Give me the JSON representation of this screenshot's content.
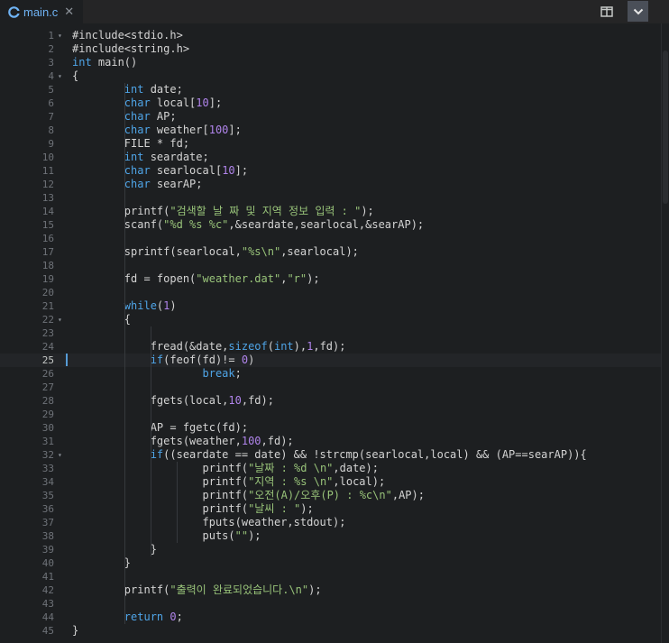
{
  "tab": {
    "title": "main.c",
    "close": "✕"
  },
  "colors": {
    "keyword": "#4fa5e8",
    "string": "#98c379",
    "number": "#b084eb",
    "text": "#d4d4d4"
  },
  "lines": [
    [
      [
        "pre",
        "#include<stdio.h>"
      ]
    ],
    [
      [
        "pre",
        "#include<string.h>"
      ]
    ],
    [
      [
        "kw",
        "int"
      ],
      [
        "t",
        " main()"
      ]
    ],
    [
      [
        "t",
        "{"
      ]
    ],
    [
      [
        "t",
        "        "
      ],
      [
        "kw",
        "int"
      ],
      [
        "t",
        " date;"
      ]
    ],
    [
      [
        "t",
        "        "
      ],
      [
        "kw",
        "char"
      ],
      [
        "t",
        " local["
      ],
      [
        "num",
        "10"
      ],
      [
        "t",
        "];"
      ]
    ],
    [
      [
        "t",
        "        "
      ],
      [
        "kw",
        "char"
      ],
      [
        "t",
        " AP;"
      ]
    ],
    [
      [
        "t",
        "        "
      ],
      [
        "kw",
        "char"
      ],
      [
        "t",
        " weather["
      ],
      [
        "num",
        "100"
      ],
      [
        "t",
        "];"
      ]
    ],
    [
      [
        "t",
        "        FILE * fd;"
      ]
    ],
    [
      [
        "t",
        "        "
      ],
      [
        "kw",
        "int"
      ],
      [
        "t",
        " seardate;"
      ]
    ],
    [
      [
        "t",
        "        "
      ],
      [
        "kw",
        "char"
      ],
      [
        "t",
        " searlocal["
      ],
      [
        "num",
        "10"
      ],
      [
        "t",
        "];"
      ]
    ],
    [
      [
        "t",
        "        "
      ],
      [
        "kw",
        "char"
      ],
      [
        "t",
        " searAP;"
      ]
    ],
    [
      [
        "t",
        ""
      ]
    ],
    [
      [
        "t",
        "        printf("
      ],
      [
        "str",
        "\"검색할 날 짜 및 지역 정보 입력 : \""
      ],
      [
        "t",
        ");"
      ]
    ],
    [
      [
        "t",
        "        scanf("
      ],
      [
        "str",
        "\"%d %s %c\""
      ],
      [
        "t",
        ",&seardate,searlocal,&searAP);"
      ]
    ],
    [
      [
        "t",
        ""
      ]
    ],
    [
      [
        "t",
        "        sprintf(searlocal,"
      ],
      [
        "str",
        "\"%s\\n\""
      ],
      [
        "t",
        ",searlocal);"
      ]
    ],
    [
      [
        "t",
        ""
      ]
    ],
    [
      [
        "t",
        "        fd = fopen("
      ],
      [
        "str",
        "\"weather.dat\""
      ],
      [
        "t",
        ","
      ],
      [
        "str",
        "\"r\""
      ],
      [
        "t",
        ");"
      ]
    ],
    [
      [
        "t",
        ""
      ]
    ],
    [
      [
        "t",
        "        "
      ],
      [
        "kw",
        "while"
      ],
      [
        "t",
        "("
      ],
      [
        "num",
        "1"
      ],
      [
        "t",
        ")"
      ]
    ],
    [
      [
        "t",
        "        {"
      ]
    ],
    [
      [
        "t",
        ""
      ]
    ],
    [
      [
        "t",
        "            fread(&date,"
      ],
      [
        "kw",
        "sizeof"
      ],
      [
        "t",
        "("
      ],
      [
        "kw",
        "int"
      ],
      [
        "t",
        "),"
      ],
      [
        "num",
        "1"
      ],
      [
        "t",
        ",fd);"
      ]
    ],
    [
      [
        "t",
        "            "
      ],
      [
        "kw",
        "if"
      ],
      [
        "t",
        "(feof(fd)!= "
      ],
      [
        "num",
        "0"
      ],
      [
        "t",
        ")"
      ]
    ],
    [
      [
        "t",
        "                    "
      ],
      [
        "kw",
        "break"
      ],
      [
        "t",
        ";"
      ]
    ],
    [
      [
        "t",
        ""
      ]
    ],
    [
      [
        "t",
        "            fgets(local,"
      ],
      [
        "num",
        "10"
      ],
      [
        "t",
        ",fd);"
      ]
    ],
    [
      [
        "t",
        ""
      ]
    ],
    [
      [
        "t",
        "            AP = fgetc(fd);"
      ]
    ],
    [
      [
        "t",
        "            fgets(weather,"
      ],
      [
        "num",
        "100"
      ],
      [
        "t",
        ",fd);"
      ]
    ],
    [
      [
        "t",
        "            "
      ],
      [
        "kw",
        "if"
      ],
      [
        "t",
        "((seardate == date) && !strcmp(searlocal,local) && (AP==searAP)){"
      ]
    ],
    [
      [
        "t",
        "                    printf("
      ],
      [
        "str",
        "\"날짜 : %d \\n\""
      ],
      [
        "t",
        ",date);"
      ]
    ],
    [
      [
        "t",
        "                    printf("
      ],
      [
        "str",
        "\"지역 : %s \\n\""
      ],
      [
        "t",
        ",local);"
      ]
    ],
    [
      [
        "t",
        "                    printf("
      ],
      [
        "str",
        "\"오전(A)/오후(P) : %c\\n\""
      ],
      [
        "t",
        ",AP);"
      ]
    ],
    [
      [
        "t",
        "                    printf("
      ],
      [
        "str",
        "\"날씨 : \""
      ],
      [
        "t",
        ");"
      ]
    ],
    [
      [
        "t",
        "                    fputs(weather,stdout);"
      ]
    ],
    [
      [
        "t",
        "                    puts("
      ],
      [
        "str",
        "\"\""
      ],
      [
        "t",
        ");"
      ]
    ],
    [
      [
        "t",
        "            }"
      ]
    ],
    [
      [
        "t",
        "        }"
      ]
    ],
    [
      [
        "t",
        ""
      ]
    ],
    [
      [
        "t",
        "        printf("
      ],
      [
        "str",
        "\"출력이 완료되었습니다.\\n\""
      ],
      [
        "t",
        ");"
      ]
    ],
    [
      [
        "t",
        ""
      ]
    ],
    [
      [
        "t",
        "        "
      ],
      [
        "kw",
        "return"
      ],
      [
        "t",
        " "
      ],
      [
        "num",
        "0"
      ],
      [
        "t",
        ";"
      ]
    ],
    [
      [
        "t",
        "}"
      ]
    ]
  ],
  "fold_lines": [
    1,
    4,
    22,
    32
  ]
}
